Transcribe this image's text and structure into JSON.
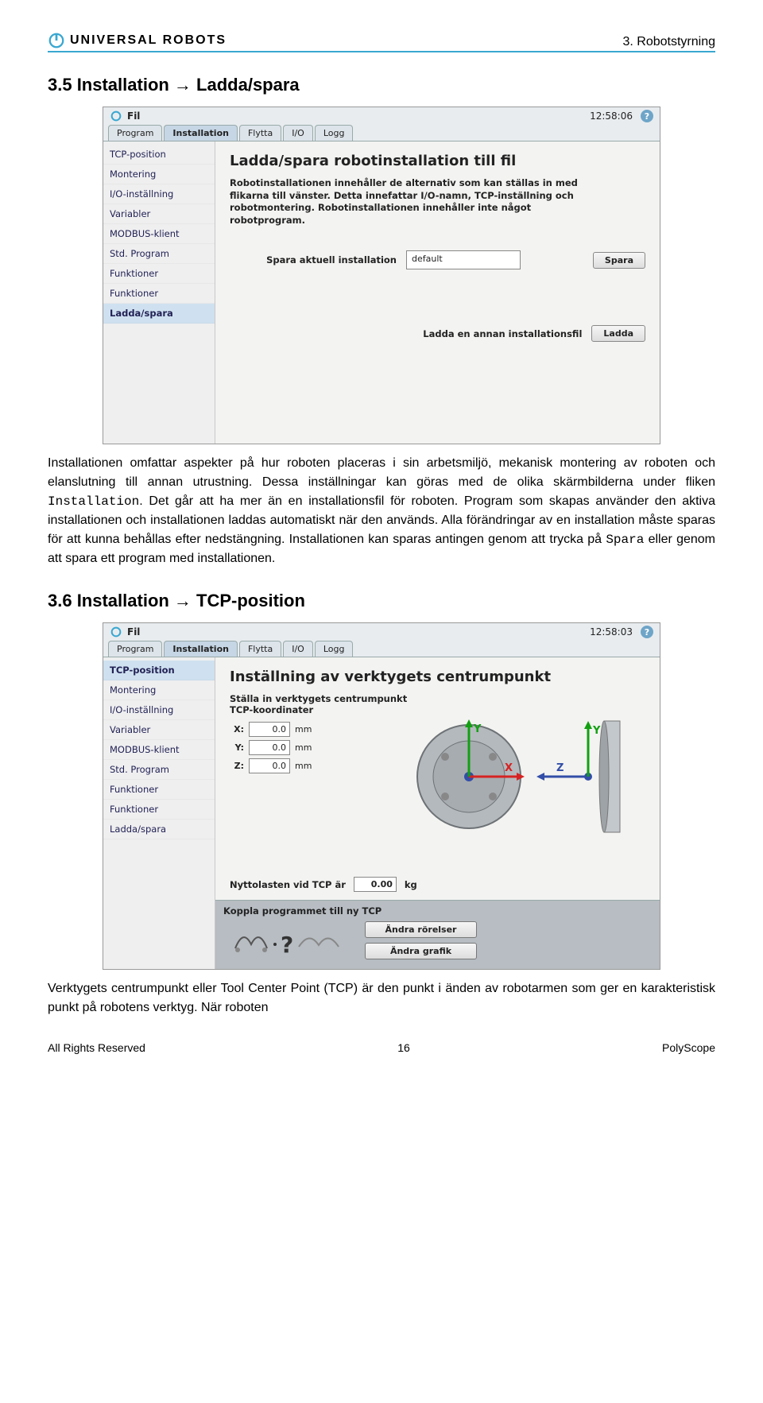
{
  "brand": "UNIVERSAL ROBOTS",
  "chapter": "3. Robotstyrning",
  "section35": {
    "heading": "3.5   Installation → Ladda/spara",
    "para_a": "Installationen omfattar aspekter på hur roboten placeras i sin arbetsmiljö, mekanisk montering av roboten och elanslutning till annan utrustning. Dessa inställningar kan göras med de olika skärmbilderna under fliken ",
    "para_a_mono": "Installation",
    "para_a2": ". Det går att ha mer än en installationsfil för roboten. Program som skapas använder den aktiva installationen och installationen laddas automatiskt när den används. Alla förändringar av en installation måste sparas för att kunna behållas efter nedstängning. Installationen kan sparas antingen genom att trycka på ",
    "para_a_mono2": "Spara",
    "para_a3": " eller genom att spara ett program med installationen."
  },
  "section36": {
    "heading": "3.6   Installation → TCP-position",
    "para": "Verktygets centrumpunkt eller Tool Center Point (TCP) är den punkt i änden av robotarmen som ger en karakteristisk punkt på robotens verktyg. När roboten"
  },
  "footer": {
    "left": "All Rights Reserved",
    "page": "16",
    "right": "PolyScope"
  },
  "shot1": {
    "menu": "Fil",
    "time": "12:58:06",
    "tabs": [
      "Program",
      "Installation",
      "Flytta",
      "I/O",
      "Logg"
    ],
    "activeTab": 1,
    "sidebar": [
      "TCP-position",
      "Montering",
      "I/O-inställning",
      "Variabler",
      "MODBUS-klient",
      "Std. Program",
      "Funktioner",
      "Funktioner",
      "Ladda/spara"
    ],
    "activeSide": 8,
    "title": "Ladda/spara robotinstallation till fil",
    "desc": "Robotinstallationen innehåller de alternativ som kan ställas in med flikarna till vänster. Detta innefattar I/O-namn, TCP-inställning och robotmontering. Robotinstallationen innehåller inte något robotprogram.",
    "save_label": "Spara aktuell installation",
    "save_value": "default",
    "save_btn": "Spara",
    "load_label": "Ladda en annan installationsfil",
    "load_btn": "Ladda"
  },
  "shot2": {
    "menu": "Fil",
    "time": "12:58:03",
    "tabs": [
      "Program",
      "Installation",
      "Flytta",
      "I/O",
      "Logg"
    ],
    "activeTab": 1,
    "sidebar": [
      "TCP-position",
      "Montering",
      "I/O-inställning",
      "Variabler",
      "MODBUS-klient",
      "Std. Program",
      "Funktioner",
      "Funktioner",
      "Ladda/spara"
    ],
    "activeSide": 0,
    "title": "Inställning av verktygets centrumpunkt",
    "sub1": "Ställa in verktygets centrumpunkt",
    "sub2": "TCP-koordinater",
    "coords": [
      {
        "label": "X:",
        "value": "0.0",
        "unit": "mm"
      },
      {
        "label": "Y:",
        "value": "0.0",
        "unit": "mm"
      },
      {
        "label": "Z:",
        "value": "0.0",
        "unit": "mm"
      }
    ],
    "payload_label": "Nyttolasten vid TCP är",
    "payload_value": "0.00",
    "payload_unit": "kg",
    "dark_title": "Koppla programmet till ny TCP",
    "btn_a": "Ändra rörelser",
    "btn_b": "Ändra grafik"
  }
}
